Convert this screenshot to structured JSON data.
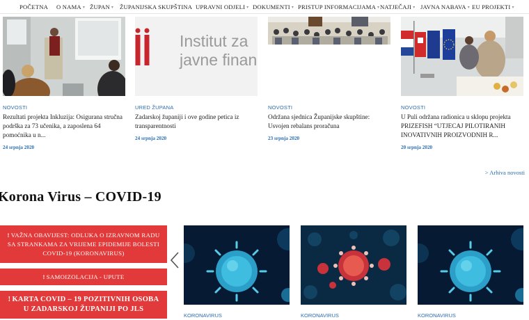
{
  "nav": {
    "items": [
      {
        "label": "POČETNA",
        "has_dropdown": false
      },
      {
        "label": "O NAMA",
        "has_dropdown": true
      },
      {
        "label": "ŽUPAN",
        "has_dropdown": true
      },
      {
        "label": "ŽUPANIJSKA SKUPŠTINA",
        "has_dropdown": false
      },
      {
        "label": "UPRAVNI ODJELI",
        "has_dropdown": true
      },
      {
        "label": "DOKUMENTI",
        "has_dropdown": true
      },
      {
        "label": "PRISTUP INFORMACIJAMA",
        "has_dropdown": true
      },
      {
        "label": "NATJEČAJI",
        "has_dropdown": true
      },
      {
        "label": "JAVNA NABAVA",
        "has_dropdown": true
      },
      {
        "label": "EU PROJEKTI",
        "has_dropdown": true
      }
    ],
    "chevron": "▾"
  },
  "news": [
    {
      "category": "NOVOSTI",
      "title": "Rezultati projekta Inkluzija: Osigurana stručna podrška za 73 učenika, a zaposlena 64 pomoćnika u n...",
      "date": "24 srpnja 2020"
    },
    {
      "category": "URED ŽUPANA",
      "title": "Zadarskoj županiji i ove godine petica iz transparentnosti",
      "date": "24 srpnja 2020",
      "image_text": "Institut za javne finan"
    },
    {
      "category": "NOVOSTI",
      "title": "Održana sjednica Županijske skupštine: Usvojen rebalans proračuna",
      "date": "23 srpnja 2020"
    },
    {
      "category": "NOVOSTI",
      "title": "U Puli održana radionica u sklopu projekta PRIZEFISH “UTJECAJ PILOTIRANIH INOVATIVNIH PROIZVODNIH R...",
      "date": "20 srpnja 2020"
    }
  ],
  "archive_link": "> Arhiva novosti",
  "covid": {
    "title": "Korona Virus – COVID-19",
    "buttons": [
      {
        "label": "VAŽNA OBAVIJEST: ODLUKA O IZRAVNOM RADU SA STRANKAMA ZA VRIJEME EPIDEMIJE BOLESTI COVID-19 (KORONAVIRUS)"
      },
      {
        "label": "SAMOIZOLACIJA - UPUTE"
      },
      {
        "label": "KARTA COVID – 19 POZITIVNIH OSOBA U ZADARSKOJ ŽUPANIJI PO JLS"
      }
    ],
    "exclamation": "!",
    "cards": [
      {
        "category": "KORONAVIRUS"
      },
      {
        "category": "KORONAVIRUS"
      },
      {
        "category": "KORONAVIRUS"
      }
    ]
  },
  "colors": {
    "accent_blue": "#2a6db0",
    "red": "#e23a3a",
    "virus_bg": "#071c3a",
    "virus_cyan": "#2fb6d8"
  },
  "icons": {
    "prev_arrow": "chevron-left-icon"
  }
}
